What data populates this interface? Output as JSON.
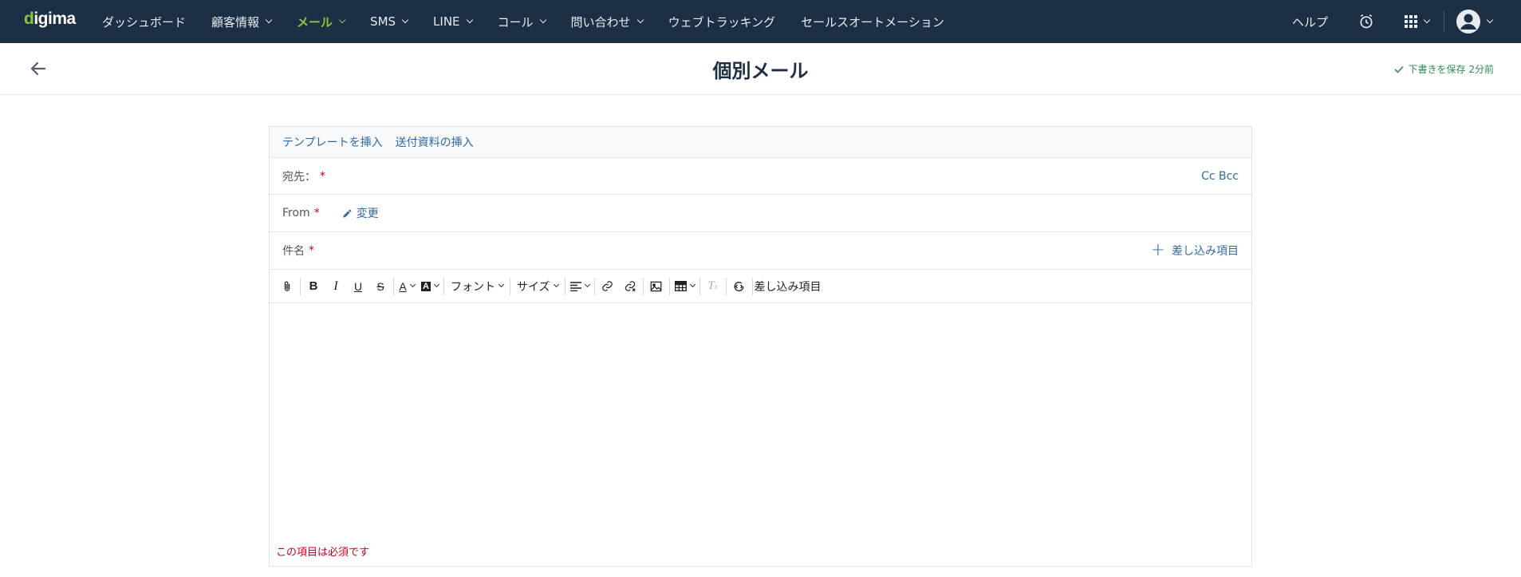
{
  "app": {
    "logo": "digima"
  },
  "nav": {
    "items": [
      {
        "label": "ダッシュボード",
        "dropdown": false,
        "active": false
      },
      {
        "label": "顧客情報",
        "dropdown": true,
        "active": false
      },
      {
        "label": "メール",
        "dropdown": true,
        "active": true
      },
      {
        "label": "SMS",
        "dropdown": true,
        "active": false
      },
      {
        "label": "LINE",
        "dropdown": true,
        "active": false
      },
      {
        "label": "コール",
        "dropdown": true,
        "active": false
      },
      {
        "label": "問い合わせ",
        "dropdown": true,
        "active": false
      },
      {
        "label": "ウェブトラッキング",
        "dropdown": false,
        "active": false
      },
      {
        "label": "セールスオートメーション",
        "dropdown": false,
        "active": false
      }
    ],
    "help_label": "ヘルプ",
    "icons": [
      "alarm-icon",
      "apps-grid-icon",
      "user-avatar-icon"
    ]
  },
  "header": {
    "title": "個別メール",
    "draft_status": "下書きを保存 2分前"
  },
  "compose": {
    "insert_template": "テンプレートを挿入",
    "insert_attachment": "送付資料の挿入",
    "to_label": "宛先：",
    "cc_bcc": "Cc Bcc",
    "from_label": "From",
    "change_label": "変更",
    "subject_label": "件名",
    "merge_field_add": "差し込み項目",
    "required_mark": "*",
    "error_message": "この項目は必須です"
  },
  "toolbar": {
    "bold": "B",
    "italic": "I",
    "underline": "U",
    "strike": "S",
    "font_color": "A",
    "bg_color": "A",
    "font": "フォント",
    "size": "サイズ",
    "clear_format": "T",
    "merge_field": "差し込み項目"
  },
  "colors": {
    "nav_bg": "#1d2f44",
    "accent": "#8cc63f",
    "link": "#2f6aa6",
    "error": "#d0021b",
    "success": "#2e8b57"
  }
}
